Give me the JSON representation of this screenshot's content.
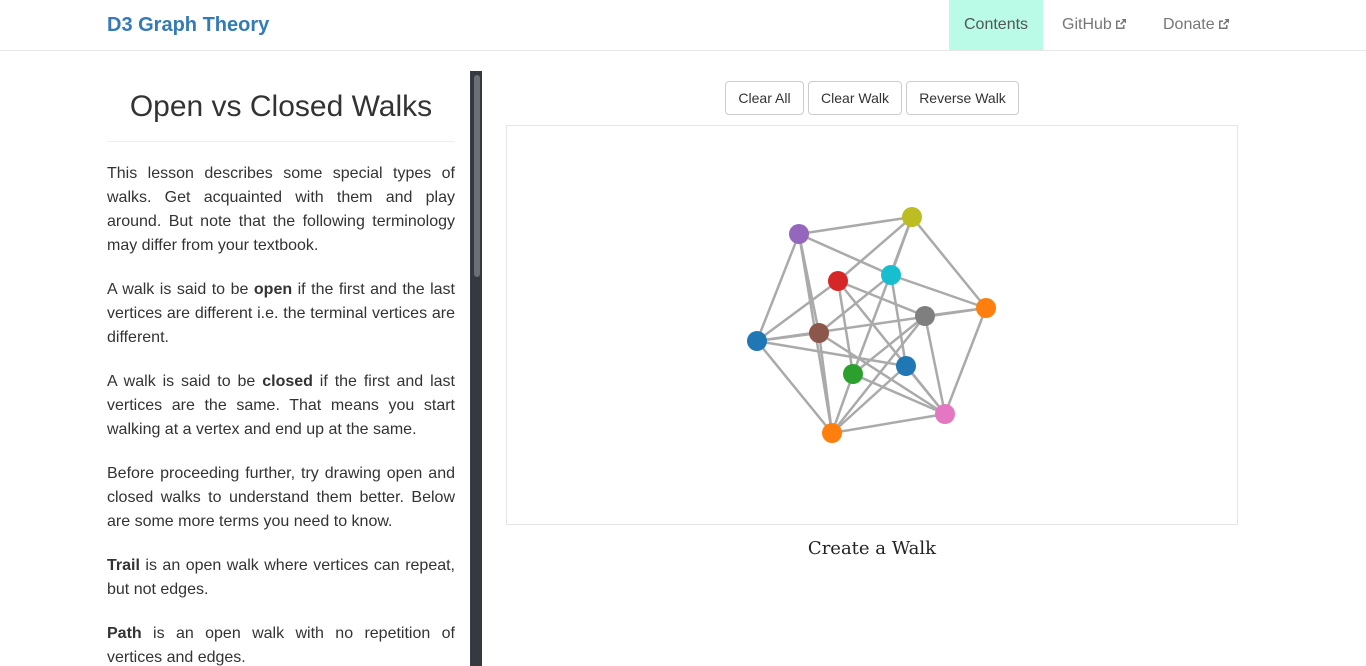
{
  "navbar": {
    "brand": "D3 Graph Theory",
    "items": [
      {
        "label": "Contents",
        "active": true
      },
      {
        "label": "GitHub",
        "external": true
      },
      {
        "label": "Donate",
        "external": true
      }
    ]
  },
  "lesson": {
    "title": "Open vs Closed Walks",
    "intro": "This lesson describes some special types of walks. Get acquainted with them and play around. But note that the following terminology may differ from your textbook.",
    "open_pre": "A walk is said to be ",
    "open_term": "open",
    "open_post": " if the first and the last vertices are different i.e. the terminal vertices are different.",
    "closed_pre": "A walk is said to be ",
    "closed_term": "closed",
    "closed_post": " if the first and last vertices are the same. That means you start walking at a vertex and end up at the same.",
    "proceed": "Before proceeding further, try drawing open and closed walks to understand them better. Below are some more terms you need to know.",
    "trail_term": "Trail",
    "trail_post": " is an open walk where vertices can repeat, but not edges.",
    "path_term": "Path",
    "path_post": " is an open walk with no repetition of vertices and edges."
  },
  "toolbar": {
    "clear_all": "Clear All",
    "clear_walk": "Clear Walk",
    "reverse_walk": "Reverse Walk"
  },
  "graph": {
    "caption": "Create a Walk",
    "edge_color": "#aaaaaa",
    "nodes": [
      {
        "id": "n0",
        "color": "#bcbd22"
      },
      {
        "id": "n1",
        "color": "#9467bd"
      },
      {
        "id": "n2",
        "color": "#d62728"
      },
      {
        "id": "n3",
        "color": "#17becf"
      },
      {
        "id": "n4",
        "color": "#ff7f0e"
      },
      {
        "id": "n5",
        "color": "#7f7f7f"
      },
      {
        "id": "n6",
        "color": "#1f77b4"
      },
      {
        "id": "n7",
        "color": "#8c564b"
      },
      {
        "id": "n8",
        "color": "#2ca02c"
      },
      {
        "id": "n9",
        "color": "#1f77b4"
      },
      {
        "id": "n10",
        "color": "#e377c2"
      },
      {
        "id": "n11",
        "color": "#ff7f0e"
      }
    ],
    "edges": [
      [
        "n0",
        "n1"
      ],
      [
        "n0",
        "n2"
      ],
      [
        "n0",
        "n3"
      ],
      [
        "n0",
        "n4"
      ],
      [
        "n0",
        "n8"
      ],
      [
        "n1",
        "n3"
      ],
      [
        "n1",
        "n6"
      ],
      [
        "n1",
        "n7"
      ],
      [
        "n1",
        "n11"
      ],
      [
        "n2",
        "n6"
      ],
      [
        "n2",
        "n8"
      ],
      [
        "n2",
        "n5"
      ],
      [
        "n2",
        "n10"
      ],
      [
        "n3",
        "n4"
      ],
      [
        "n3",
        "n7"
      ],
      [
        "n3",
        "n9"
      ],
      [
        "n4",
        "n5"
      ],
      [
        "n4",
        "n10"
      ],
      [
        "n4",
        "n6"
      ],
      [
        "n5",
        "n8"
      ],
      [
        "n5",
        "n11"
      ],
      [
        "n5",
        "n10"
      ],
      [
        "n6",
        "n7"
      ],
      [
        "n6",
        "n11"
      ],
      [
        "n6",
        "n9"
      ],
      [
        "n7",
        "n10"
      ],
      [
        "n7",
        "n11"
      ],
      [
        "n8",
        "n11"
      ],
      [
        "n8",
        "n10"
      ],
      [
        "n9",
        "n11"
      ],
      [
        "n9",
        "n10"
      ],
      [
        "n10",
        "n11"
      ]
    ]
  }
}
